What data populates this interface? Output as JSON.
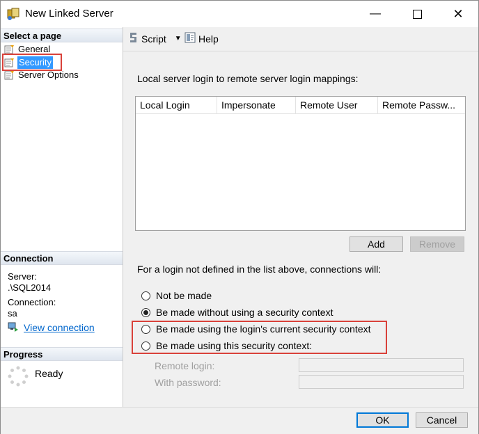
{
  "window": {
    "title": "New Linked Server"
  },
  "left": {
    "select_page": "Select a page",
    "pages": [
      {
        "label": "General",
        "selected": false
      },
      {
        "label": "Security",
        "selected": true
      },
      {
        "label": "Server Options",
        "selected": false
      }
    ],
    "connection": {
      "header": "Connection",
      "server_label": "Server:",
      "server_value": ".\\SQL2014",
      "connection_label": "Connection:",
      "connection_value": "sa",
      "view_link": "View connection"
    },
    "progress": {
      "header": "Progress",
      "status": "Ready"
    }
  },
  "toolbar": {
    "script": "Script",
    "help": "Help"
  },
  "main": {
    "mappings_label": "Local server login to remote server login mappings:",
    "columns": [
      "Local Login",
      "Impersonate",
      "Remote User",
      "Remote Passw..."
    ],
    "add": "Add",
    "remove": "Remove",
    "connections_label": "For a login not defined in the list above, connections will:",
    "options": [
      {
        "label": "Not be made",
        "checked": false
      },
      {
        "label": "Be made without using a security context",
        "checked": true
      },
      {
        "label": "Be made using the login's current security context",
        "checked": false
      },
      {
        "label": "Be made using this security context:",
        "checked": false
      }
    ],
    "remote_login": "Remote login:",
    "with_password": "With password:"
  },
  "footer": {
    "ok": "OK",
    "cancel": "Cancel"
  },
  "colors": {
    "selection": "#3399ff",
    "highlight_border": "#d9413a",
    "link": "#0066cc",
    "default_button_border": "#0078d7"
  }
}
